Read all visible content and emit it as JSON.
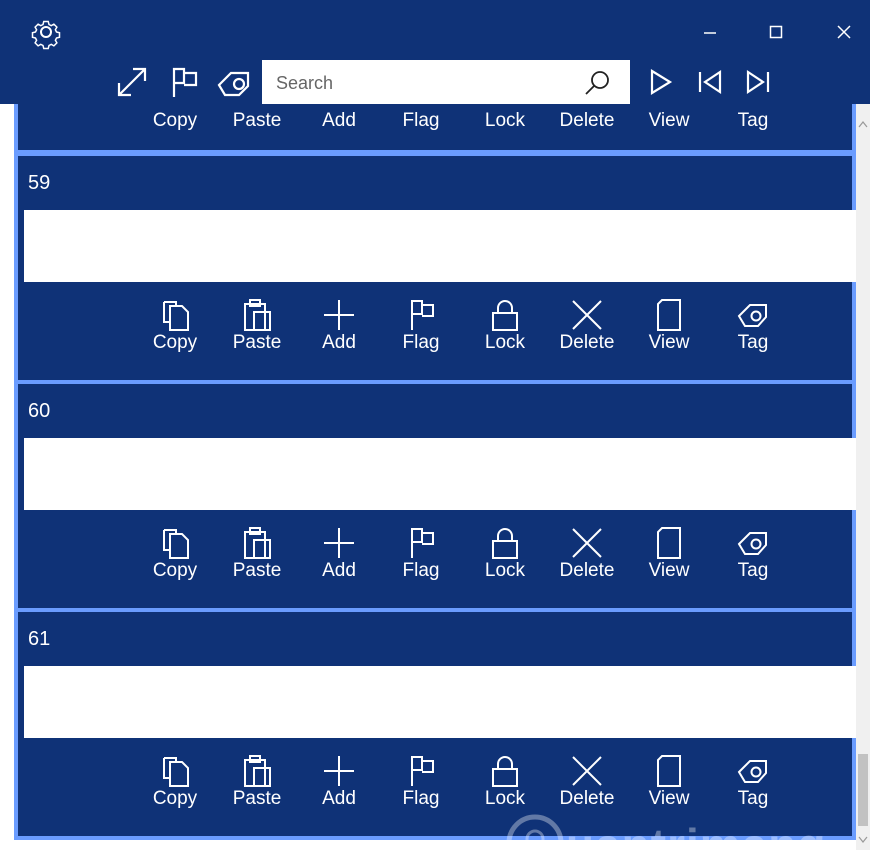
{
  "window": {
    "icons": {
      "settings": "gear-icon",
      "minimize": "minimize-icon",
      "maximize": "maximize-icon",
      "close": "close-icon"
    }
  },
  "toolbar": {
    "icons": [
      "expand-icon",
      "flag-icon",
      "tag-icon",
      "play-icon",
      "skip-back-icon",
      "skip-forward-icon"
    ],
    "search": {
      "placeholder": "Search",
      "value": ""
    }
  },
  "actions": [
    "Copy",
    "Paste",
    "Add",
    "Flag",
    "Lock",
    "Delete",
    "View",
    "Tag"
  ],
  "cards": [
    {
      "number": "",
      "partial": true
    },
    {
      "number": "59",
      "text": ""
    },
    {
      "number": "60",
      "text": ""
    },
    {
      "number": "61",
      "text": ""
    }
  ],
  "watermark": {
    "text": "uantrimang"
  },
  "colors": {
    "background": "#0f3277",
    "border": "#6a9cff",
    "text": "#ffffff"
  }
}
